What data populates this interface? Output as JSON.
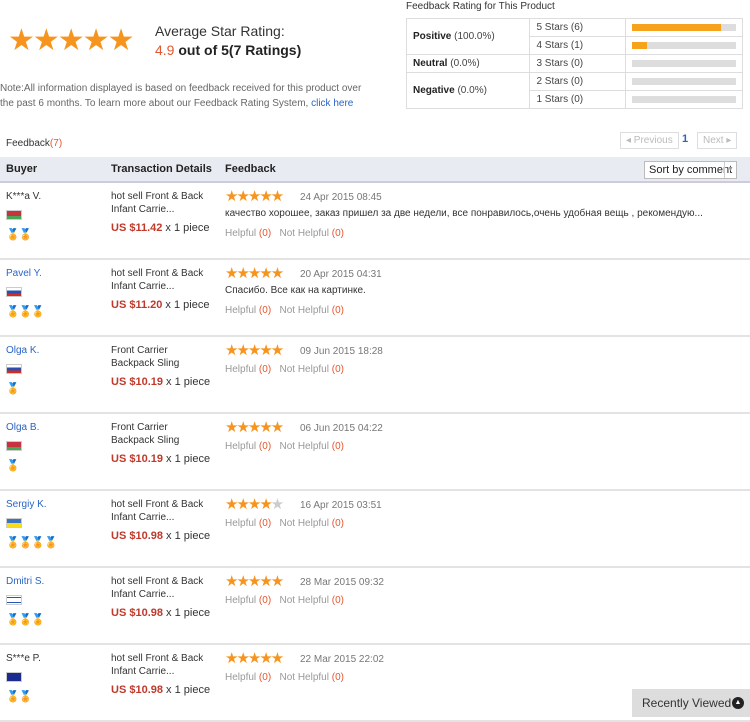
{
  "summary": {
    "stars": "★★★★★",
    "label": "Average Star Rating:",
    "score": "4.9",
    "out_of": " out of 5(7 Ratings)",
    "note": "Note:All information displayed is based on feedback received for this product over the past 6 months. To learn more about our Feedback Rating System, ",
    "note_link": "click here"
  },
  "rating_table": {
    "title": "Feedback Rating for This Product",
    "categories": [
      {
        "name": "Positive",
        "pct": "(100.0%)"
      },
      {
        "name": "Neutral",
        "pct": "(0.0%)"
      },
      {
        "name": "Negative",
        "pct": "(0.0%)"
      }
    ],
    "levels": [
      {
        "label": "5 Stars (6)",
        "fraction": 0.857
      },
      {
        "label": "4 Stars (1)",
        "fraction": 0.143
      },
      {
        "label": "3 Stars (0)",
        "fraction": 0
      },
      {
        "label": "2 Stars (0)",
        "fraction": 0
      },
      {
        "label": "1 Stars (0)",
        "fraction": 0
      }
    ],
    "bar_color": "#f7a21b"
  },
  "feedback": {
    "label": "Feedback",
    "count": "(7)",
    "prev": "◂ Previous",
    "page": "1",
    "next": "Next ▸"
  },
  "columns": {
    "buyer": "Buyer",
    "transaction": "Transaction Details",
    "feedback": "Feedback",
    "sort": "Sort by comment",
    "sort_arrow": "▼"
  },
  "rows": [
    {
      "buyer": "K***a V.",
      "link": false,
      "flag": "belarus",
      "medals": "🏅🏅",
      "product": "hot sell Front & Back Infant Carrie...",
      "price": "US $11.42",
      "qty": " x 1 piece",
      "rating": 5,
      "date": "24 Apr 2015 08:45",
      "comment": "качество хорошее, заказ пришел за две недели, все понравилось,очень удобная вещь , рекомендую...",
      "helpful": "Helpful",
      "helpful_n": "(0)",
      "not_helpful": "Not Helpful",
      "not_helpful_n": "(0)"
    },
    {
      "buyer": "Pavel Y.",
      "link": true,
      "flag": "russia",
      "medals": "🏅🏅🏅",
      "product": "hot sell Front & Back Infant Carrie...",
      "price": "US $11.20",
      "qty": " x 1 piece",
      "rating": 5,
      "date": "20 Apr 2015 04:31",
      "comment": "Спасибо. Все как на картинке.",
      "helpful": "Helpful",
      "helpful_n": "(0)",
      "not_helpful": "Not Helpful",
      "not_helpful_n": "(0)"
    },
    {
      "buyer": "Olga K.",
      "link": true,
      "flag": "russia",
      "medals": "🏅",
      "product": "Front Carrier Backpack Sling",
      "price": "US $10.19",
      "qty": " x 1 piece",
      "rating": 5,
      "date": "09 Jun 2015 18:28",
      "comment": "",
      "helpful": "Helpful",
      "helpful_n": "(0)",
      "not_helpful": "Not Helpful",
      "not_helpful_n": "(0)"
    },
    {
      "buyer": "Olga B.",
      "link": true,
      "flag": "belarus",
      "medals": "🏅",
      "product": "Front Carrier Backpack Sling",
      "price": "US $10.19",
      "qty": " x 1 piece",
      "rating": 5,
      "date": "06 Jun 2015 04:22",
      "comment": "",
      "helpful": "Helpful",
      "helpful_n": "(0)",
      "not_helpful": "Not Helpful",
      "not_helpful_n": "(0)"
    },
    {
      "buyer": "Sergiy K.",
      "link": true,
      "flag": "ukraine",
      "medals": "🏅🏅🏅🏅",
      "product": "hot sell Front & Back Infant Carrie...",
      "price": "US $10.98",
      "qty": " x 1 piece",
      "rating": 4,
      "date": "16 Apr 2015 03:51",
      "comment": "",
      "helpful": "Helpful",
      "helpful_n": "(0)",
      "not_helpful": "Not Helpful",
      "not_helpful_n": "(0)"
    },
    {
      "buyer": "Dmitri S.",
      "link": true,
      "flag": "israel",
      "medals": "🏅🏅🏅",
      "product": "hot sell Front & Back Infant Carrie...",
      "price": "US $10.98",
      "qty": " x 1 piece",
      "rating": 5,
      "date": "28 Mar 2015 09:32",
      "comment": "",
      "helpful": "Helpful",
      "helpful_n": "(0)",
      "not_helpful": "Not Helpful",
      "not_helpful_n": "(0)"
    },
    {
      "buyer": "S***e P.",
      "link": false,
      "flag": "australia",
      "medals": "🏅🏅",
      "product": "hot sell Front & Back Infant Carrie...",
      "price": "US $10.98",
      "qty": " x 1 piece",
      "rating": 5,
      "date": "22 Mar 2015 22:02",
      "comment": "",
      "helpful": "Helpful",
      "helpful_n": "(0)",
      "not_helpful": "Not Helpful",
      "not_helpful_n": "(0)"
    }
  ],
  "recently_viewed": "Recently Viewed"
}
